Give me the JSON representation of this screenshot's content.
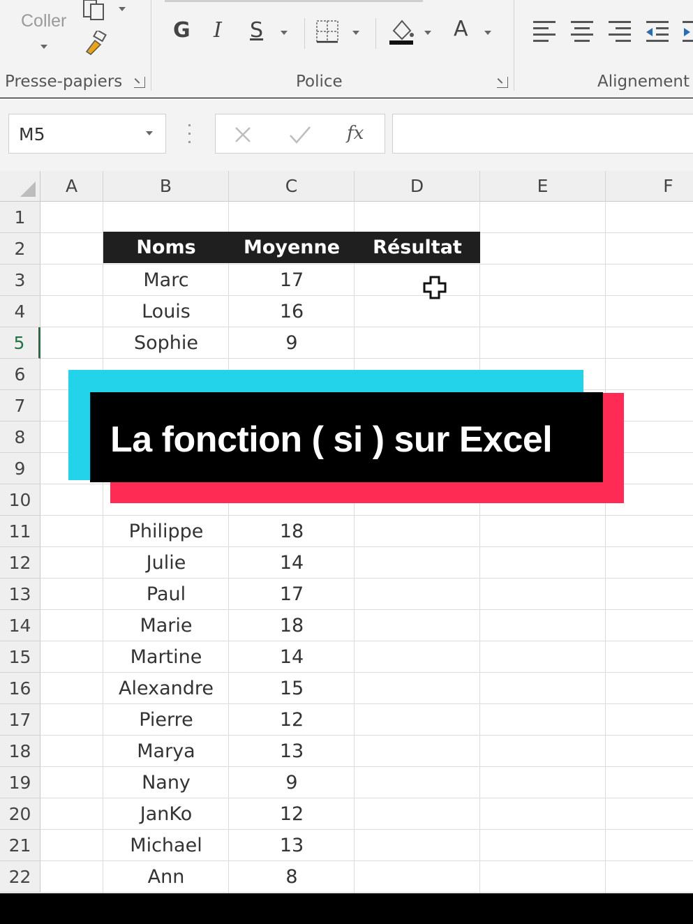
{
  "ribbon": {
    "paste_label": "Coller",
    "groups": [
      {
        "label": "Presse-papiers"
      },
      {
        "label": "Police"
      },
      {
        "label": "Alignement"
      }
    ],
    "font_buttons": {
      "bold": "G",
      "italic": "I",
      "underline": "S",
      "font_color": "A"
    }
  },
  "formula_bar": {
    "name_box": "M5",
    "fx": "fx",
    "value": ""
  },
  "sheet": {
    "columns": [
      "A",
      "B",
      "C",
      "D",
      "E",
      "F"
    ],
    "rows": [
      "1",
      "2",
      "3",
      "4",
      "5",
      "6",
      "7",
      "8",
      "9",
      "10",
      "11",
      "12",
      "13",
      "14",
      "15",
      "16",
      "17",
      "18",
      "19",
      "20",
      "21",
      "22"
    ],
    "table_header": {
      "name": "Noms",
      "avg": "Moyenne",
      "result": "Résultat"
    },
    "data": [
      {
        "row": 3,
        "name": "Marc",
        "avg": "17"
      },
      {
        "row": 4,
        "name": "Louis",
        "avg": "16"
      },
      {
        "row": 5,
        "name": "Sophie",
        "avg": "9"
      },
      {
        "row": 11,
        "name": "Philippe",
        "avg": "18"
      },
      {
        "row": 12,
        "name": "Julie",
        "avg": "14"
      },
      {
        "row": 13,
        "name": "Paul",
        "avg": "17"
      },
      {
        "row": 14,
        "name": "Marie",
        "avg": "18"
      },
      {
        "row": 15,
        "name": "Martine",
        "avg": "14"
      },
      {
        "row": 16,
        "name": "Alexandre",
        "avg": "15"
      },
      {
        "row": 17,
        "name": "Pierre",
        "avg": "12"
      },
      {
        "row": 18,
        "name": "Marya",
        "avg": "13"
      },
      {
        "row": 19,
        "name": "Nany",
        "avg": "9"
      },
      {
        "row": 20,
        "name": "JanKo",
        "avg": "12"
      },
      {
        "row": 21,
        "name": "Michael",
        "avg": "13"
      },
      {
        "row": 22,
        "name": "Ann",
        "avg": "8"
      }
    ],
    "active_row": "5"
  },
  "overlay": {
    "title": "La fonction ( si ) sur Excel"
  },
  "colors": {
    "cyan": "#22d3ea",
    "red": "#fe2c55",
    "header_bg": "#1f1f1f",
    "excel_green": "#217346"
  }
}
